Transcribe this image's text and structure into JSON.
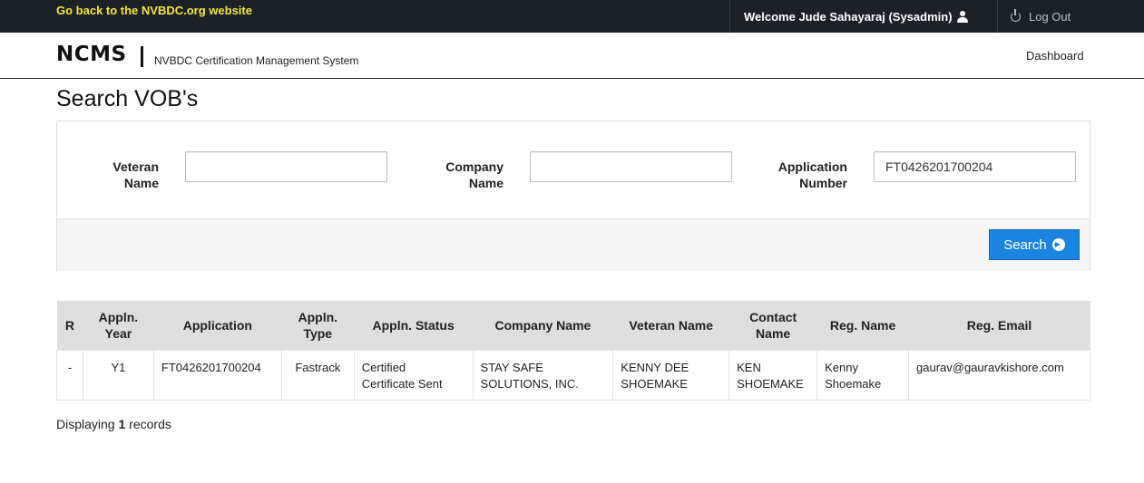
{
  "topbar": {
    "back_link": "Go back to the NVBDC.org website",
    "welcome": "Welcome Jude Sahayaraj (Sysadmin)",
    "logout": "Log Out"
  },
  "header": {
    "brand": "NCMS",
    "subtitle": "NVBDC Certification Management System",
    "nav_dashboard": "Dashboard"
  },
  "page_title": "Search VOB's",
  "search": {
    "veteran_name_label_1": "Veteran",
    "veteran_name_label_2": "Name",
    "veteran_name_value": "",
    "company_name_label_1": "Company",
    "company_name_label_2": "Name",
    "company_name_value": "",
    "application_number_label_1": "Application",
    "application_number_label_2": "Number",
    "application_number_value": "FT0426201700204",
    "button_label": "Search"
  },
  "table": {
    "headers": [
      [
        "R"
      ],
      [
        "Appln.",
        "Year"
      ],
      [
        "Application"
      ],
      [
        "Appln.",
        "Type"
      ],
      [
        "Appln. Status"
      ],
      [
        "Company Name"
      ],
      [
        "Veteran Name"
      ],
      [
        "Contact",
        "Name"
      ],
      [
        "Reg. Name"
      ],
      [
        "Reg. Email"
      ]
    ],
    "rows": [
      {
        "r": "-",
        "year": "Y1",
        "application": "FT0426201700204",
        "type": "Fastrack",
        "status_1": "Certified",
        "status_2": "Certificate Sent",
        "company_1": "STAY SAFE",
        "company_2": "SOLUTIONS, INC.",
        "veteran_1": "KENNY DEE",
        "veteran_2": "SHOEMAKE",
        "contact_1": "KEN",
        "contact_2": "SHOEMAKE",
        "reg_name_1": "Kenny",
        "reg_name_2": "Shoemake",
        "reg_email": "gaurav@gauravkishore.com"
      }
    ]
  },
  "records": {
    "prefix": "Displaying",
    "count": "1",
    "suffix": "records"
  },
  "colors": {
    "topbar_bg": "#1c2128",
    "back_link": "#f5e53c",
    "search_button": "#1a84e0",
    "table_header_bg": "#dedede"
  }
}
